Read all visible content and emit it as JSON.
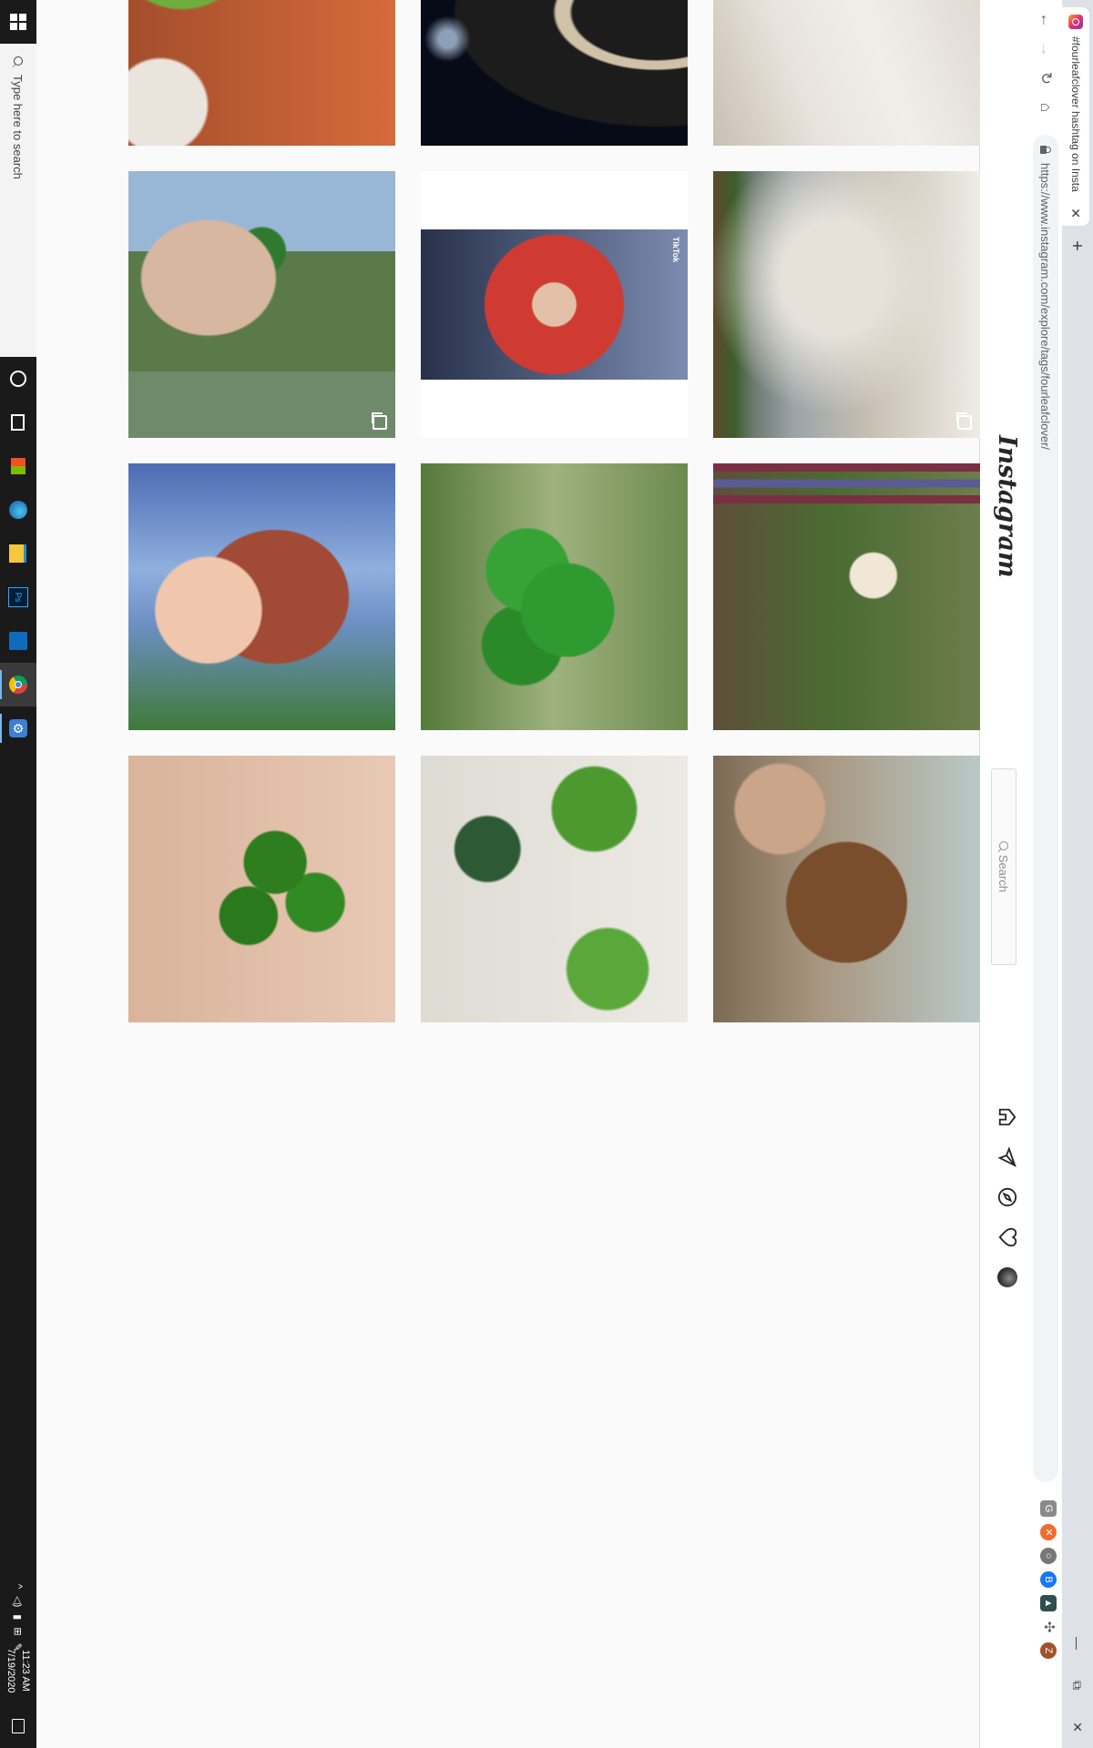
{
  "browser": {
    "tab_title": "#fourleafclover hashtag on Insta",
    "tab_close": "✕",
    "new_tab": "+",
    "url": "https://www.instagram.com/explore/tags/fourleafclover/",
    "window_controls": {
      "minimize": "—",
      "restore": "⧉",
      "close": "✕"
    }
  },
  "instagram": {
    "logo": "Instagram",
    "search_placeholder": "Search"
  },
  "posts": [
    {
      "row": 1,
      "col": 1,
      "badge": "multi"
    },
    {
      "row": 1,
      "col": 2,
      "badge": "none"
    },
    {
      "row": 1,
      "col": 3,
      "badge": "none"
    },
    {
      "row": 2,
      "col": 1,
      "badge": "video",
      "overlay_text": "TikTok"
    },
    {
      "row": 2,
      "col": 2,
      "badge": "none"
    },
    {
      "row": 2,
      "col": 3,
      "badge": "none"
    },
    {
      "row": 3,
      "col": 1,
      "badge": "multi"
    },
    {
      "row": 3,
      "col": 2,
      "badge": "none"
    },
    {
      "row": 3,
      "col": 3,
      "badge": "none"
    }
  ],
  "taskbar": {
    "search_placeholder": "Type here to search",
    "time": "11:23 AM",
    "date": "7/19/2020"
  },
  "colors": {
    "tab_strip": "#dee1e6",
    "instagram_bg": "#fafafa",
    "taskbar": "#1a1a1a",
    "clover_green": "#2e8b2e"
  }
}
